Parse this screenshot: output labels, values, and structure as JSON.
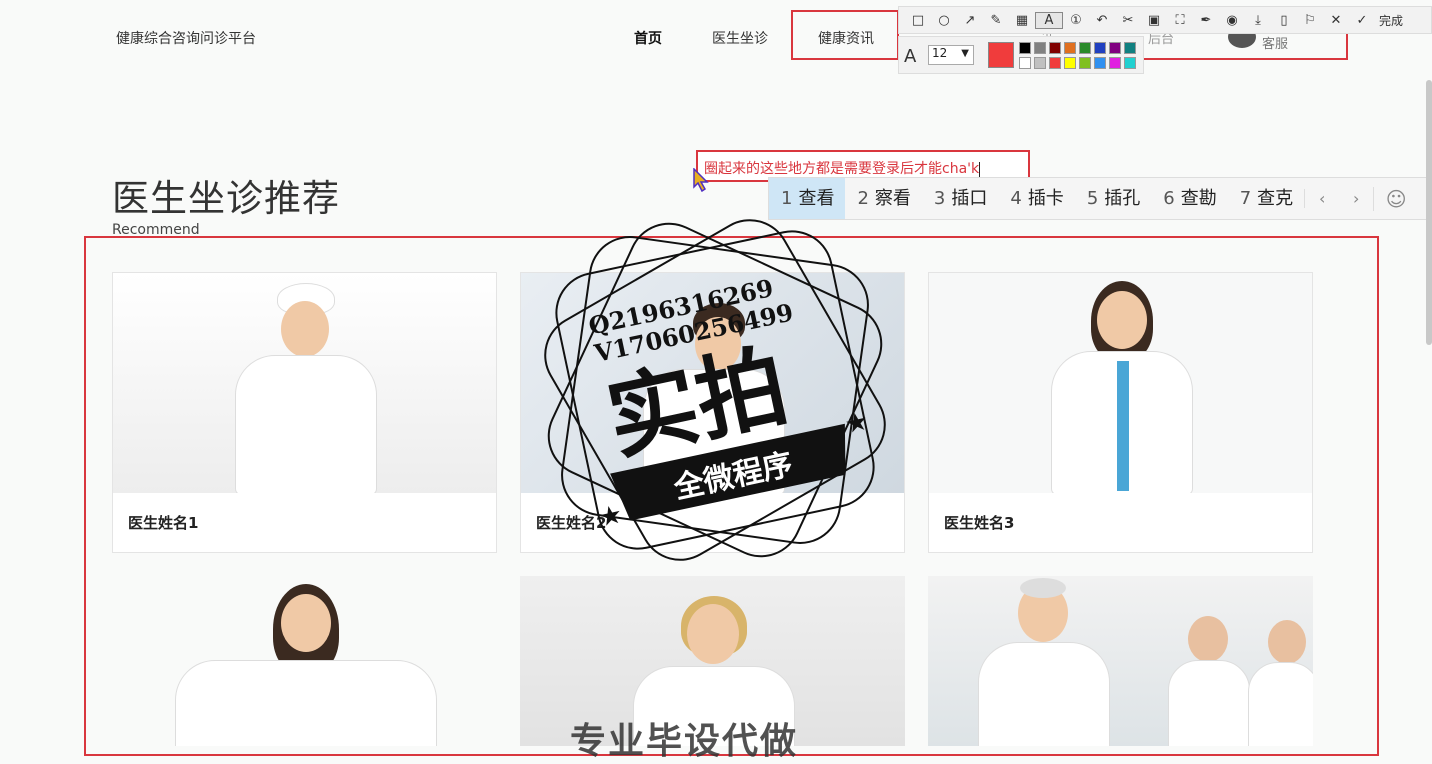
{
  "header": {
    "brand": "健康综合咨询问诊平台",
    "nav": [
      "首页",
      "医生坐诊",
      "健康资讯"
    ],
    "partial_nav": [
      "讯",
      "后台"
    ],
    "customer_service": "客服"
  },
  "section": {
    "title": "医生坐诊推荐",
    "subtitle": "Recommend"
  },
  "doctors": [
    {
      "name": "医生姓名1"
    },
    {
      "name": "医生姓名2"
    },
    {
      "name": "医生姓名3"
    }
  ],
  "overlays": {
    "stamp_line1": "Q2196316269",
    "stamp_line2": "V17060256499",
    "stamp_main": "实拍",
    "stamp_banner": "全微程序",
    "bottom_text": "专业毕设代做"
  },
  "screenshot_tool": {
    "toolbar_icons": [
      "rect-icon",
      "ellipse-icon",
      "arrow-icon",
      "pen-icon",
      "mosaic-icon",
      "text-icon",
      "number-icon",
      "undo-icon",
      "crop-icon",
      "ocr-icon",
      "expand-icon",
      "pin-icon",
      "record-icon",
      "download-icon",
      "phone-icon",
      "bookmark-icon",
      "close-icon",
      "check-icon"
    ],
    "done_label": "完成",
    "font_size": "12",
    "current_color": "#f03c3c",
    "palette_row1": [
      "#000000",
      "#808080",
      "#800000",
      "#e07020",
      "#2a8a2a",
      "#2040c0",
      "#800080",
      "#108080"
    ],
    "palette_row2": [
      "#ffffff",
      "#c0c0c0",
      "#f03c3c",
      "#ffff00",
      "#80c020",
      "#3090f0",
      "#e020e0",
      "#20d0d0"
    ]
  },
  "annotation": {
    "text": "圈起来的这些地方都是需要登录后才能cha'k"
  },
  "ime": {
    "candidates": [
      {
        "num": "1",
        "word": "查看"
      },
      {
        "num": "2",
        "word": "察看"
      },
      {
        "num": "3",
        "word": "插口"
      },
      {
        "num": "4",
        "word": "插卡"
      },
      {
        "num": "5",
        "word": "插孔"
      },
      {
        "num": "6",
        "word": "查勘"
      },
      {
        "num": "7",
        "word": "查克"
      }
    ],
    "prev": "‹",
    "next": "›",
    "emoji": "☺"
  },
  "colors": {
    "accent_red": "#d9363e",
    "ime_selected": "#cfe6f6"
  }
}
